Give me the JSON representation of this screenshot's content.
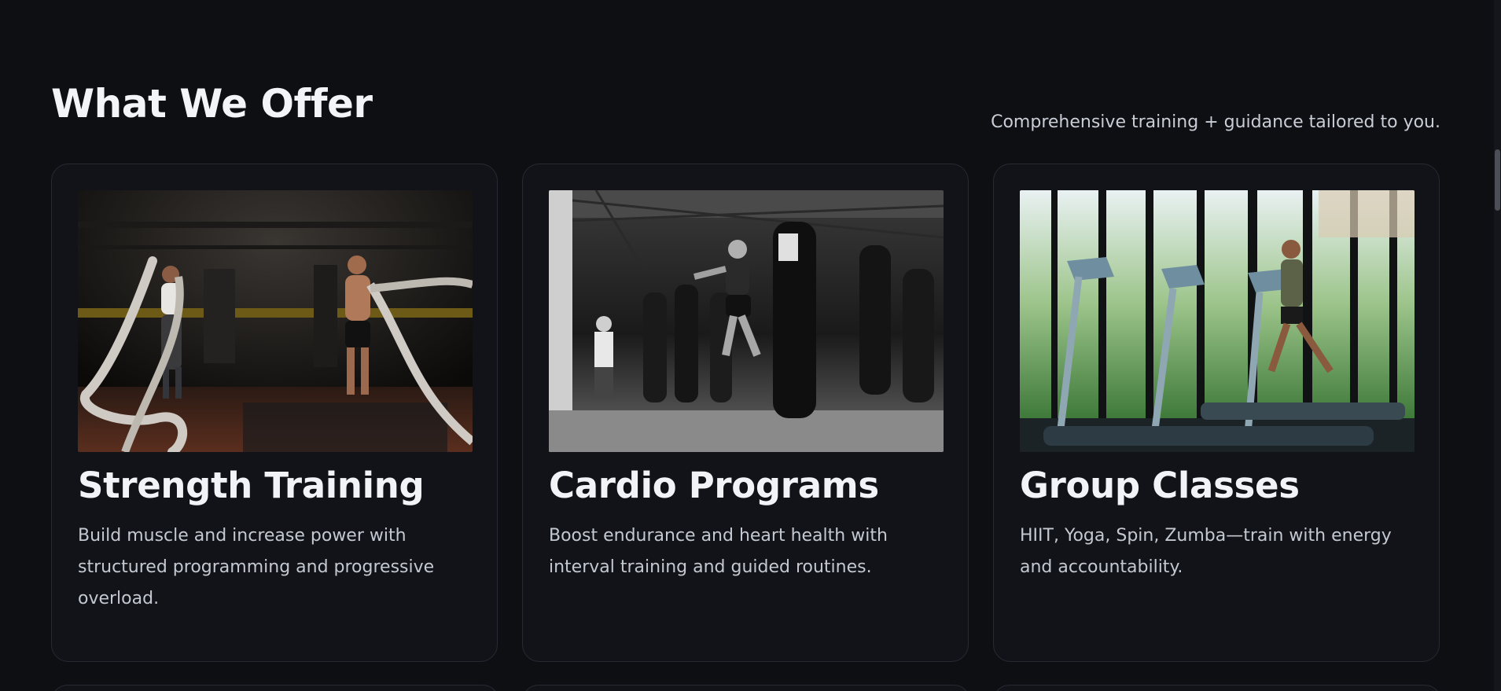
{
  "section": {
    "title": "What We Offer",
    "subtitle": "Comprehensive training + guidance tailored to you."
  },
  "cards": [
    {
      "title": "Strength Training",
      "description": "Build muscle and increase power with structured programming and progressive overload.",
      "image": "battle-ropes-photo"
    },
    {
      "title": "Cardio Programs",
      "description": "Boost endurance and heart health with interval training and guided routines.",
      "image": "boxing-gym-photo"
    },
    {
      "title": "Group Classes",
      "description": "HIIT, Yoga, Spin, Zumba—train with energy and accountability.",
      "image": "treadmill-photo"
    }
  ],
  "colors": {
    "background": "#0d0f13",
    "card": "#111318",
    "border": "#262a33"
  }
}
